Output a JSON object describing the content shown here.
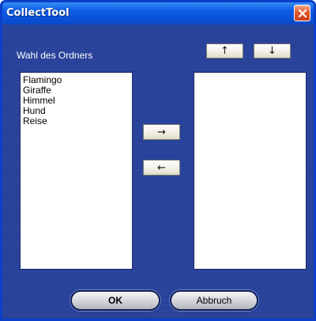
{
  "window": {
    "title": "CollectTool",
    "close_icon": "close-icon"
  },
  "folder_label": "Wahl des Ordners",
  "move_up_label": "↑",
  "move_down_label": "↓",
  "add_label": "→",
  "remove_label": "←",
  "source_list": {
    "items": [
      "Flamingo",
      "Giraffe",
      "Himmel",
      "Hund",
      "Reise"
    ]
  },
  "target_list": {
    "items": []
  },
  "ok_label": "OK",
  "cancel_label": "Abbruch",
  "colors": {
    "title_bar": "#0a52d9",
    "client_bg": "#27419a",
    "close_button": "#e2582d"
  }
}
